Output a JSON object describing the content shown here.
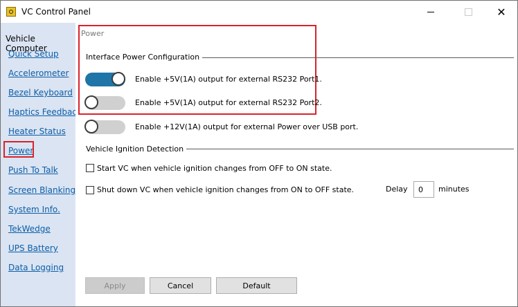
{
  "window": {
    "title": "VC Control Panel"
  },
  "sidebar": {
    "heading": "Vehicle Computer",
    "items": [
      {
        "label": "Quick Setup"
      },
      {
        "label": "Accelerometer"
      },
      {
        "label": "Bezel Keyboard"
      },
      {
        "label": "Haptics Feedback"
      },
      {
        "label": "Heater Status"
      },
      {
        "label": "Power",
        "selected": true
      },
      {
        "label": "Push To Talk"
      },
      {
        "label": "Screen Blanking"
      },
      {
        "label": "System Info."
      },
      {
        "label": "TekWedge"
      },
      {
        "label": "UPS Battery"
      },
      {
        "label": "Data Logging"
      }
    ]
  },
  "content": {
    "breadcrumb": "Power",
    "interface_group": {
      "title": "Interface Power Configuration",
      "options": [
        {
          "label": "Enable +5V(1A) output for external RS232 Port1.",
          "on": true
        },
        {
          "label": "Enable +5V(1A) output for external RS232 Port2.",
          "on": false
        },
        {
          "label": "Enable +12V(1A) output for external Power over USB port.",
          "on": false
        }
      ]
    },
    "ignition_group": {
      "title": "Vehicle Ignition Detection",
      "start_label": "Start VC when vehicle ignition changes from OFF to ON state.",
      "start_checked": false,
      "shutdown_label": "Shut down VC when vehicle ignition changes from ON to OFF state.",
      "shutdown_checked": false,
      "delay_label": "Delay",
      "delay_value": "0",
      "minutes_label": "minutes"
    },
    "buttons": {
      "apply": "Apply",
      "cancel": "Cancel",
      "default": "Default"
    }
  },
  "colors": {
    "toggle_on": "#1f74a8",
    "toggle_off": "#d0d0d0",
    "highlight": "#d9222a",
    "sidebar_bg": "#dbe4f2",
    "link": "#0b5ea8"
  }
}
